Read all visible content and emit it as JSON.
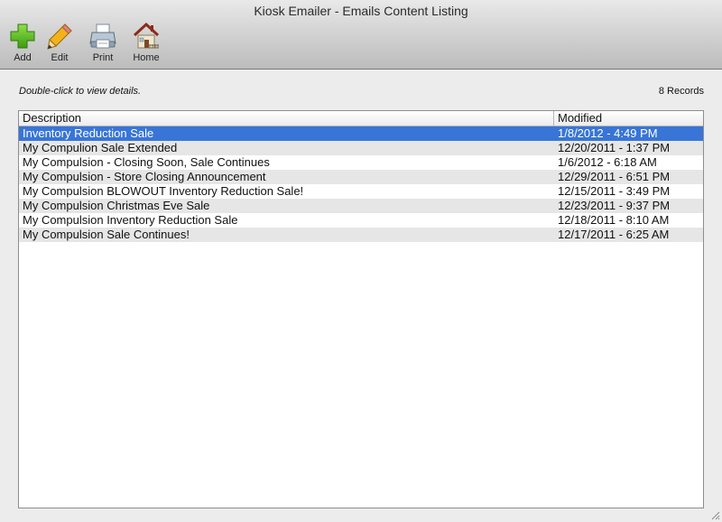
{
  "window": {
    "title": "Kiosk Emailer - Emails Content Listing"
  },
  "toolbar": {
    "add_label": "Add",
    "edit_label": "Edit",
    "print_label": "Print",
    "home_label": "Home",
    "add_icon": "plus-icon",
    "edit_icon": "pencil-icon",
    "print_icon": "printer-icon",
    "home_icon": "house-icon"
  },
  "info": {
    "hint": "Double-click to view details.",
    "record_count": "8 Records"
  },
  "table": {
    "columns": [
      "Description",
      "Modified"
    ],
    "selected_index": 0,
    "rows": [
      {
        "description": "Inventory Reduction Sale",
        "modified": "1/8/2012 - 4:49 PM"
      },
      {
        "description": "My Compulion Sale Extended",
        "modified": "12/20/2011 - 1:37 PM"
      },
      {
        "description": "My Compulsion - Closing Soon, Sale Continues",
        "modified": "1/6/2012 - 6:18 AM"
      },
      {
        "description": "My Compulsion - Store Closing Announcement",
        "modified": "12/29/2011 - 6:51 PM"
      },
      {
        "description": "My Compulsion BLOWOUT Inventory Reduction Sale!",
        "modified": "12/15/2011 - 3:49 PM"
      },
      {
        "description": "My Compulsion Christmas Eve Sale",
        "modified": "12/23/2011 - 9:37 PM"
      },
      {
        "description": "My Compulsion Inventory Reduction Sale",
        "modified": "12/18/2011 - 8:10 AM"
      },
      {
        "description": "My Compulsion Sale Continues!",
        "modified": "12/17/2011 - 6:25 AM"
      }
    ]
  },
  "colors": {
    "selection": "#3875d7",
    "alt_row": "#e6e6e6",
    "add_green": "#4caf1a"
  }
}
